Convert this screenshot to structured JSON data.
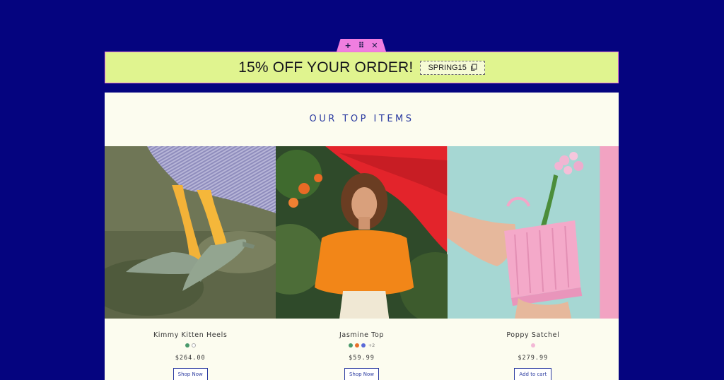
{
  "editor_handle": {
    "add_glyph": "+",
    "drag_glyph": "⠿",
    "close_glyph": "✕"
  },
  "promo": {
    "headline": "15% OFF YOUR ORDER!",
    "code": "SPRING15",
    "copy_icon": "copy-icon"
  },
  "section": {
    "title": "OUR TOP ITEMS"
  },
  "products": [
    {
      "name": "Kimmy Kitten Heels",
      "swatches": [
        "#4a9a6c",
        "#ffffff"
      ],
      "more": "",
      "price": "$264.00",
      "cta": "Shop Now"
    },
    {
      "name": "Jasmine Top",
      "swatches": [
        "#4a9a6c",
        "#e8702a",
        "#5a6ad8"
      ],
      "more": "+2",
      "price": "$59.99",
      "cta": "Shop Now"
    },
    {
      "name": "Poppy Satchel",
      "swatches": [
        "#f3b8d6"
      ],
      "more": "",
      "price": "$279.99",
      "cta": "Add to cart"
    }
  ],
  "colors": {
    "background": "#05047f",
    "banner": "#e0f48f",
    "banner_border": "#ec7ad3",
    "panel": "#fcfcef",
    "accent": "#2a3aa0",
    "handle": "#f07ee0"
  }
}
